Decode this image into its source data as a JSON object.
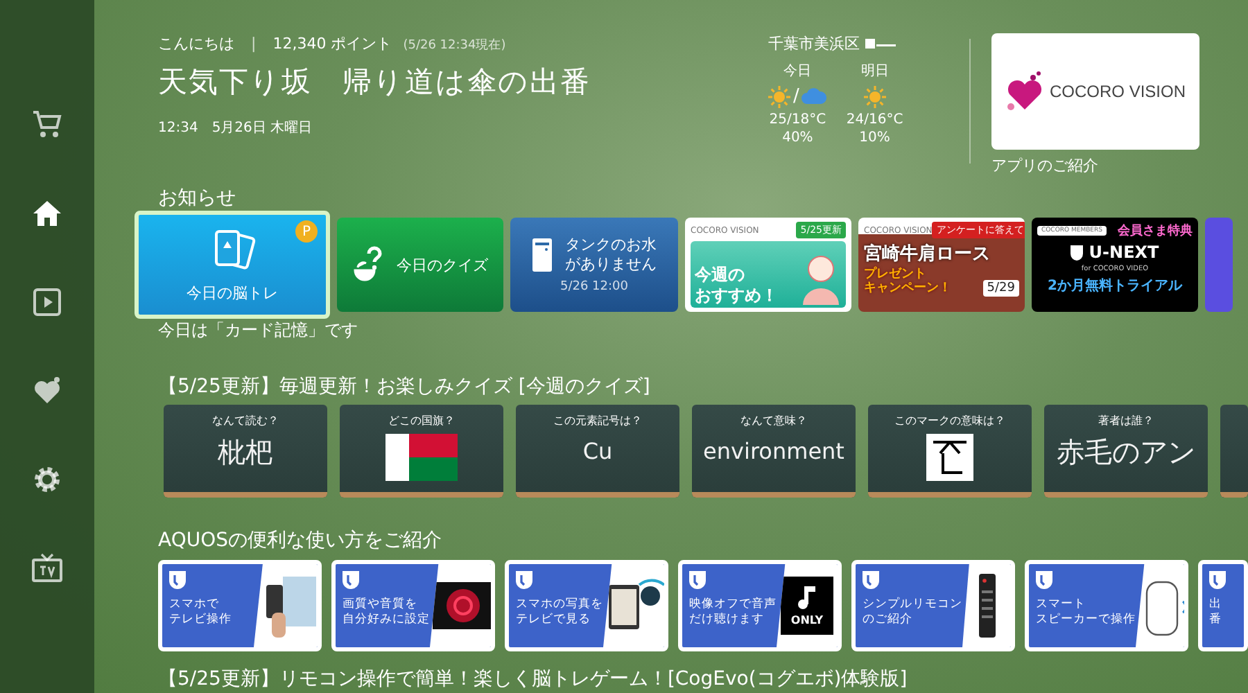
{
  "sidebar": {
    "items": [
      {
        "kind": "cart",
        "selected": false
      },
      {
        "kind": "home",
        "selected": true
      },
      {
        "kind": "play",
        "selected": false
      },
      {
        "kind": "heart",
        "selected": false
      },
      {
        "kind": "gear",
        "selected": false
      },
      {
        "kind": "tv",
        "selected": false
      }
    ]
  },
  "header": {
    "greeting": "こんにちは",
    "separator": "|",
    "points": "12,340 ポイント",
    "points_time": "(5/26 12:34現在)",
    "headline": "天気下り坂　帰り道は傘の出番",
    "datetime": "12:34　5月26日 木曜日"
  },
  "weather": {
    "location": "千葉市美浜区",
    "days": [
      {
        "label": "今日",
        "icons": [
          {
            "kind": "sun"
          },
          {
            "kind": "rain"
          }
        ],
        "separator": "/",
        "temps": "25/18°C",
        "rain_chance": "40%"
      },
      {
        "label": "明日",
        "icons": [
          {
            "kind": "sun"
          }
        ],
        "temps": "24/16°C",
        "rain_chance": "10%"
      }
    ]
  },
  "app_promo": {
    "logo_text": "COCORO VISION",
    "caption": "アプリのご紹介"
  },
  "notices": {
    "heading": "お知らせ",
    "items": [
      {
        "kind": "brain",
        "label": "今日の脳トレ",
        "badge": "P",
        "selected": true
      },
      {
        "kind": "quiz",
        "label": "今日のクイズ",
        "selected": false
      },
      {
        "kind": "tank",
        "lines": [
          "タンクのお水",
          "がありません"
        ],
        "time": "5/26 12:00",
        "selected": false
      },
      {
        "kind": "weekly",
        "brand": "COCORO VISION",
        "tag": "5/25更新",
        "lines": [
          "今週の",
          "おすすめ！"
        ],
        "selected": false
      },
      {
        "kind": "campaign",
        "brand": "COCORO VISION",
        "tag": "アンケートに答えて",
        "title": "宮崎牛肩ロース",
        "lines": [
          "プレゼント",
          "キャンペーン！"
        ],
        "date": "5/29",
        "selected": false
      },
      {
        "kind": "unext",
        "brand": "COCORO MEMBERS",
        "tag": "会員さま特典",
        "title": "U-NEXT",
        "subtitle": "for COCORO VIDEO",
        "offer": "2か月無料トライアル",
        "selected": false
      },
      {
        "kind": "more",
        "selected": false
      }
    ],
    "caption": "今日は「カード記憶」です"
  },
  "quiz": {
    "heading": "【5/25更新】毎週更新！お楽しみクイズ [今週のクイズ]",
    "items": [
      {
        "question": "なんて読む？",
        "kind": "text",
        "answer": "枇杷"
      },
      {
        "question": "どこの国旗？",
        "kind": "flag"
      },
      {
        "question": "この元素記号は？",
        "kind": "text",
        "answer": "Cu"
      },
      {
        "question": "なんて意味？",
        "kind": "text",
        "answer": "environment"
      },
      {
        "question": "このマークの意味は？",
        "kind": "mark"
      },
      {
        "question": "著者は誰？",
        "kind": "text",
        "answer": "赤毛のアン"
      },
      {
        "kind": "blank"
      }
    ]
  },
  "guides": {
    "heading": "AQUOSの便利な使い方をご紹介",
    "items": [
      {
        "lines": [
          "スマホで",
          "テレビ操作"
        ],
        "kind": "phone"
      },
      {
        "lines": [
          "画質や音質を",
          "自分好みに設定"
        ],
        "kind": "rose"
      },
      {
        "lines": [
          "スマホの写真を",
          "テレビで見る"
        ],
        "kind": "tablet"
      },
      {
        "lines": [
          "映像オフで音声",
          "だけ聴けます"
        ],
        "kind": "music",
        "image_text": "ONLY"
      },
      {
        "lines": [
          "シンプルリモコン",
          "のご紹介"
        ],
        "kind": "remote"
      },
      {
        "lines": [
          "スマート",
          "スピーカーで操作"
        ],
        "kind": "speaker"
      },
      {
        "lines": [
          "出",
          "番"
        ],
        "kind": "partial"
      }
    ]
  },
  "next_section": {
    "heading": "【5/25更新】リモコン操作で簡単！楽しく脳トレゲーム！[CogEvo(コグエボ)体験版]"
  }
}
